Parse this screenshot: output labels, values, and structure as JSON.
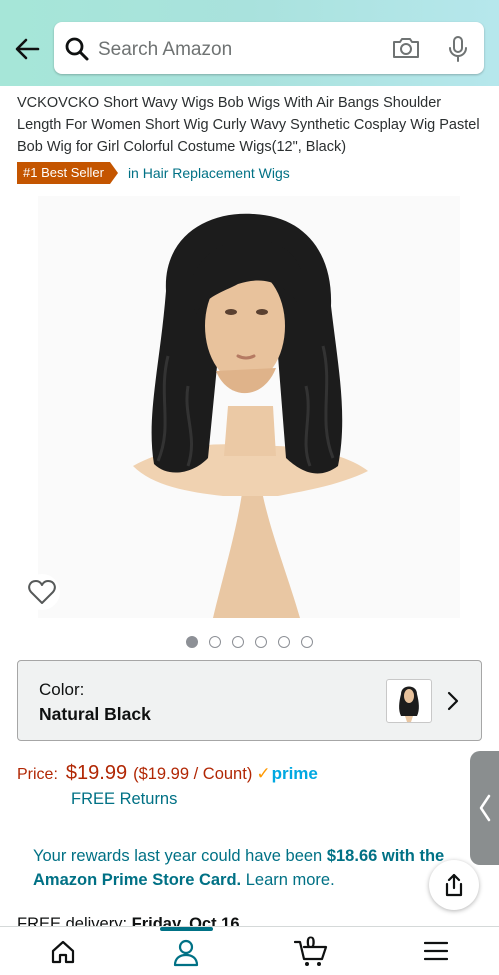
{
  "header": {
    "search_placeholder": "Search Amazon"
  },
  "product": {
    "title": "VCKOVCKO Short Wavy Wigs Bob Wigs With Air Bangs Shoulder Length For Women Short Wig Curly Wavy Synthetic Cosplay Wig Pastel Bob Wig for Girl Colorful Costume Wigs(12\", Black)",
    "badge": "#1 Best Seller",
    "badge_category": "in Hair Replacement Wigs",
    "image_count": 6,
    "active_image": 1
  },
  "color": {
    "label": "Color:",
    "value": "Natural Black"
  },
  "price": {
    "label": "Price:",
    "amount": "$19.99",
    "unit_price": "($19.99 / Count)",
    "prime": "prime",
    "returns": "FREE Returns"
  },
  "rewards": {
    "text_prefix": "Your rewards last year could have been ",
    "amount_text": "$18.66 with the Amazon Prime Store Card.",
    "link": " Learn more."
  },
  "delivery": {
    "label": "FREE delivery: ",
    "date": "Friday, Oct 16"
  },
  "nav": {
    "cart_count": "0"
  },
  "colors": {
    "header_bg": "#a9e2dd",
    "price": "#b12704",
    "link": "#007185",
    "badge": "#c45500",
    "prime": "#00a8e1"
  }
}
